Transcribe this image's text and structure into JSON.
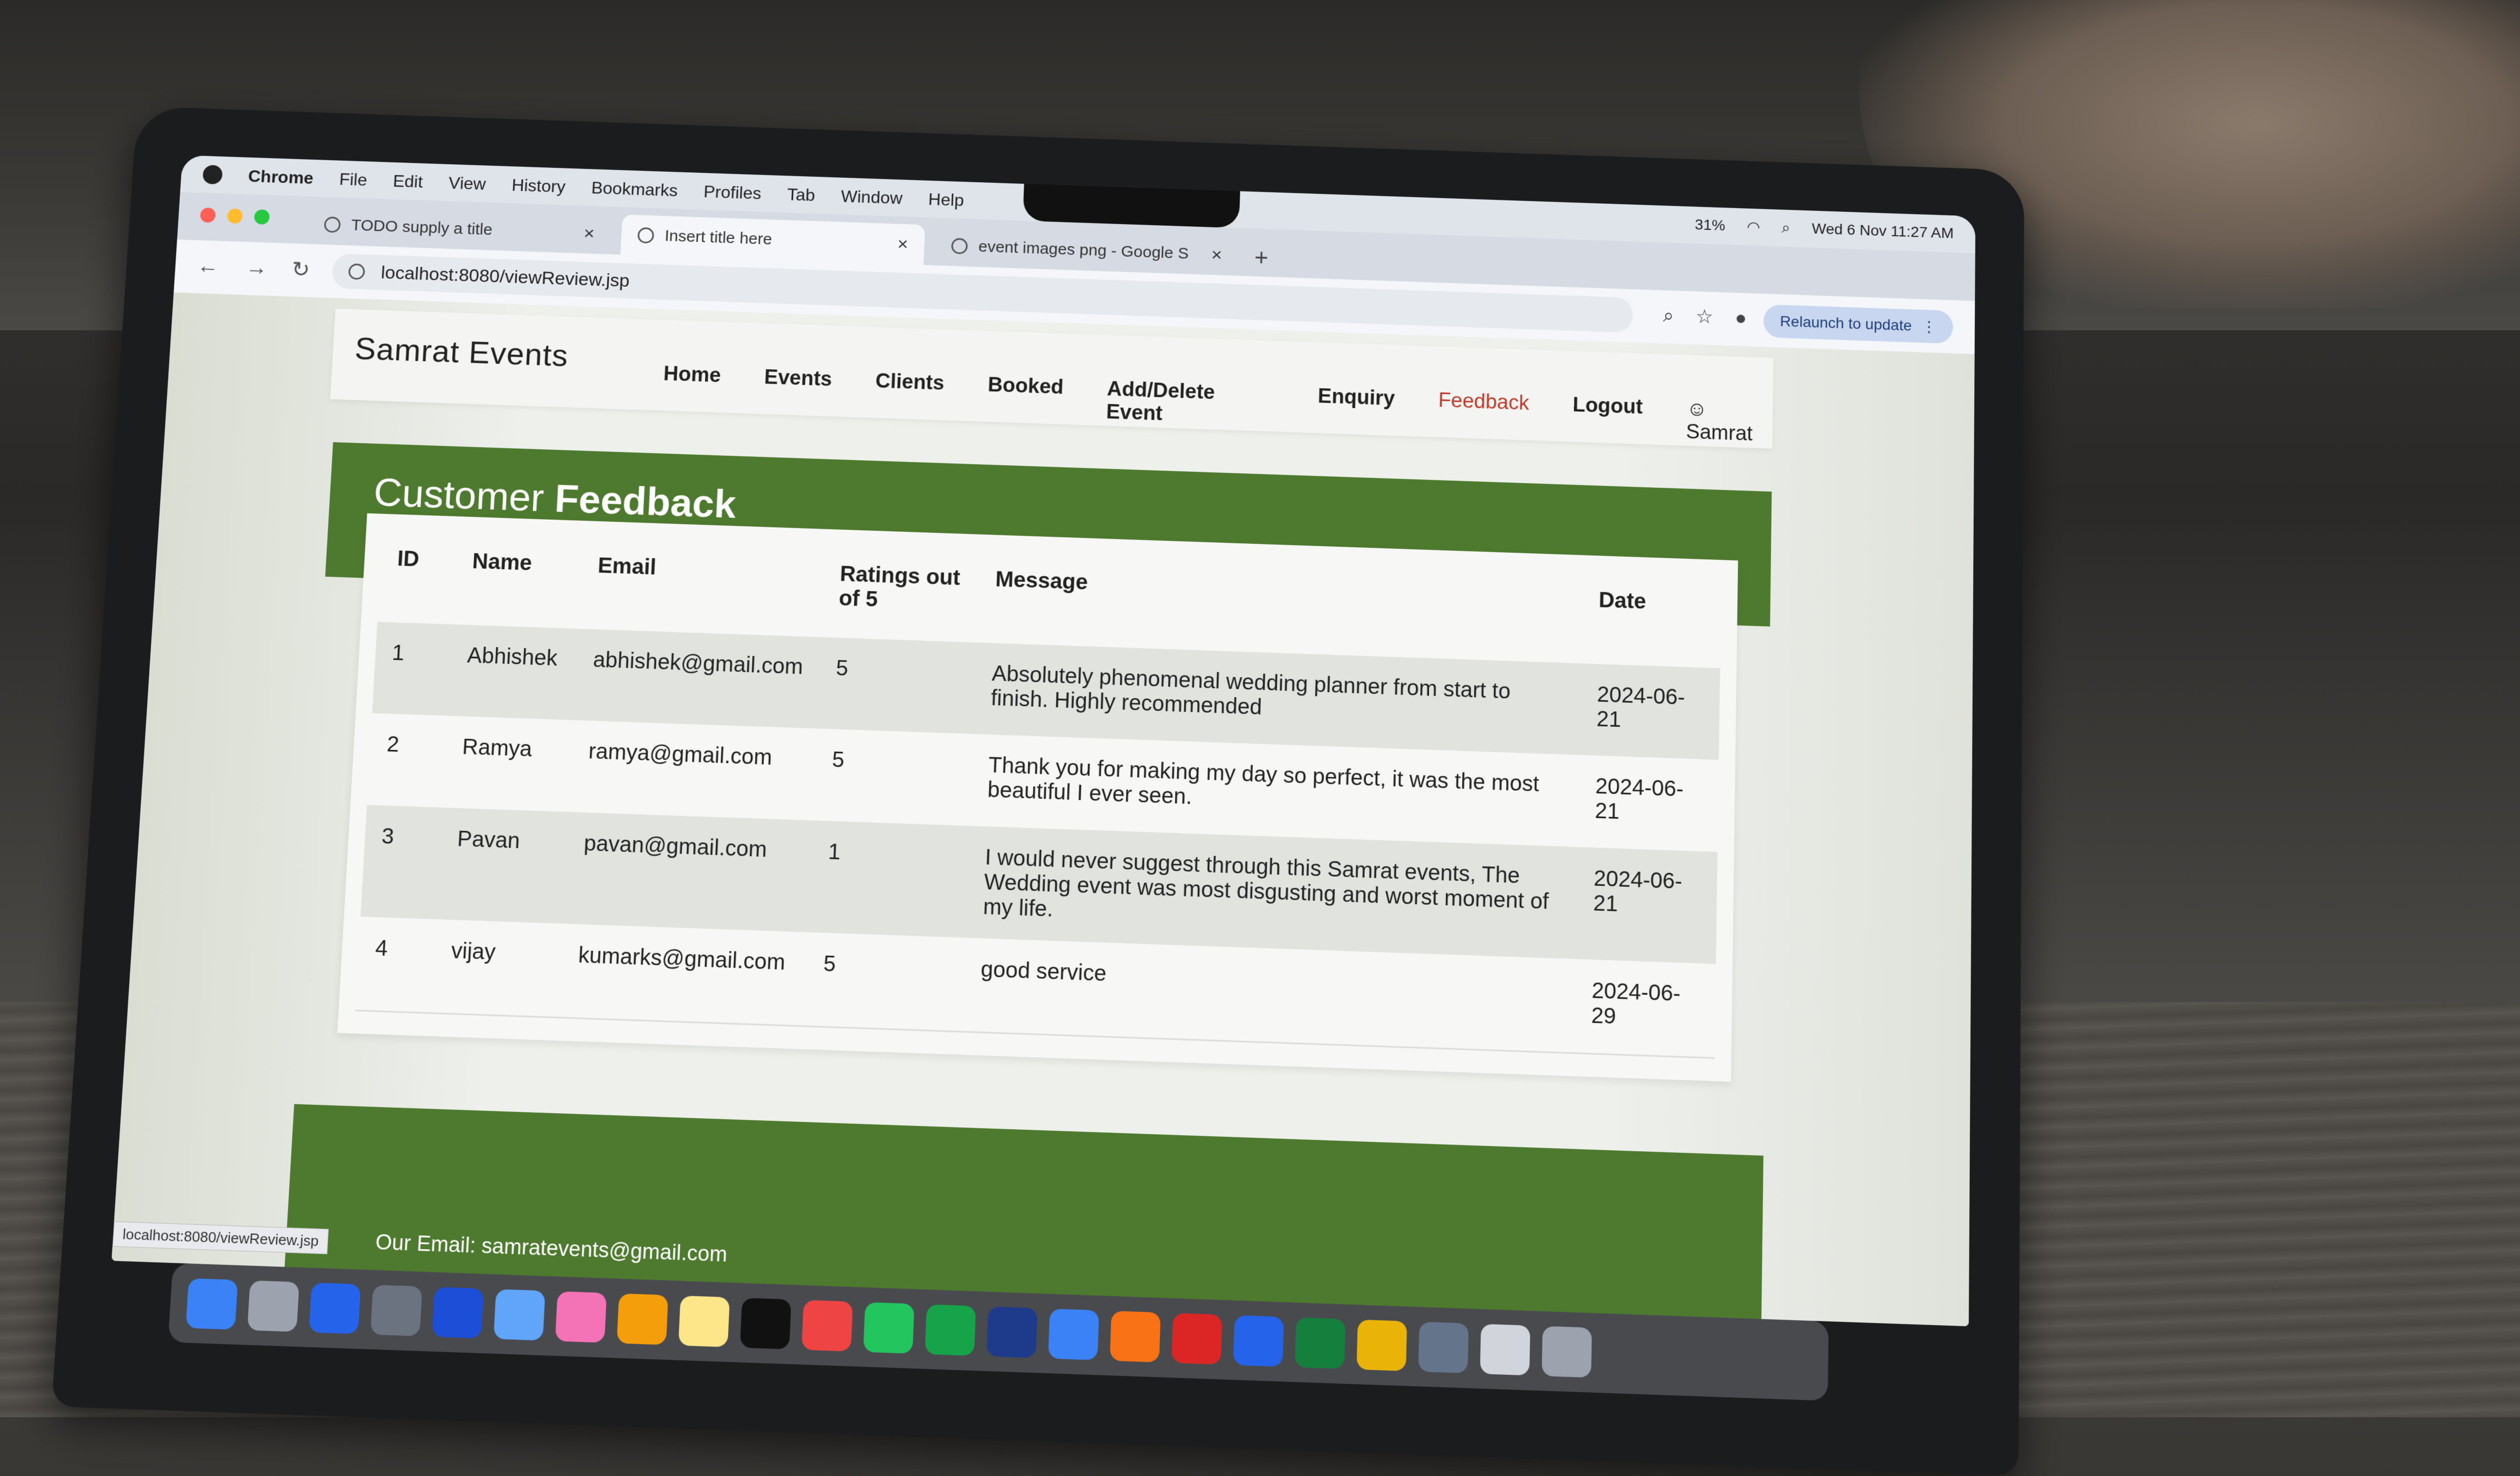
{
  "menubar": {
    "app": "Chrome",
    "items": [
      "File",
      "Edit",
      "View",
      "History",
      "Bookmarks",
      "Profiles",
      "Tab",
      "Window",
      "Help"
    ],
    "battery": "31%",
    "datetime": "Wed 6 Nov  11:27 AM"
  },
  "tabs": [
    {
      "title": "TODO supply a title"
    },
    {
      "title": "Insert title here"
    },
    {
      "title": "event images png - Google S"
    }
  ],
  "addressbar": {
    "url": "localhost:8080/viewReview.jsp",
    "relaunch": "Relaunch to update"
  },
  "site": {
    "brand": "Samrat Events",
    "nav": [
      "Home",
      "Events",
      "Clients",
      "Booked",
      "Add/Delete Event",
      "Enquiry",
      "Feedback",
      "Logout"
    ],
    "user": "Samrat"
  },
  "banner": {
    "title_a": "Customer",
    "title_b": "Feedback"
  },
  "table": {
    "headers": [
      "ID",
      "Name",
      "Email",
      "Ratings out of 5",
      "Message",
      "Date"
    ],
    "rows": [
      [
        "1",
        "Abhishek",
        "abhishek@gmail.com",
        "5",
        "Absolutely phenomenal wedding planner from start to finish. Highly recommended",
        "2024-06-21"
      ],
      [
        "2",
        "Ramya",
        "ramya@gmail.com",
        "5",
        "Thank you for making my day so perfect, it was the most beautiful I ever seen.",
        "2024-06-21"
      ],
      [
        "3",
        "Pavan",
        "pavan@gmail.com",
        "1",
        "I would never suggest through this Samrat events, The Wedding event was most disgusting and worst moment of my life.",
        "2024-06-21"
      ],
      [
        "4",
        "vijay",
        "kumarks@gmail.com",
        "5",
        "good service",
        "2024-06-29"
      ]
    ]
  },
  "footer": {
    "email": "Our Email: samratevents@gmail.com"
  },
  "statusbar": {
    "url": "localhost:8080/viewReview.jsp"
  },
  "colors": {
    "green": "#4e7a2f",
    "active_link": "#c0392b"
  }
}
